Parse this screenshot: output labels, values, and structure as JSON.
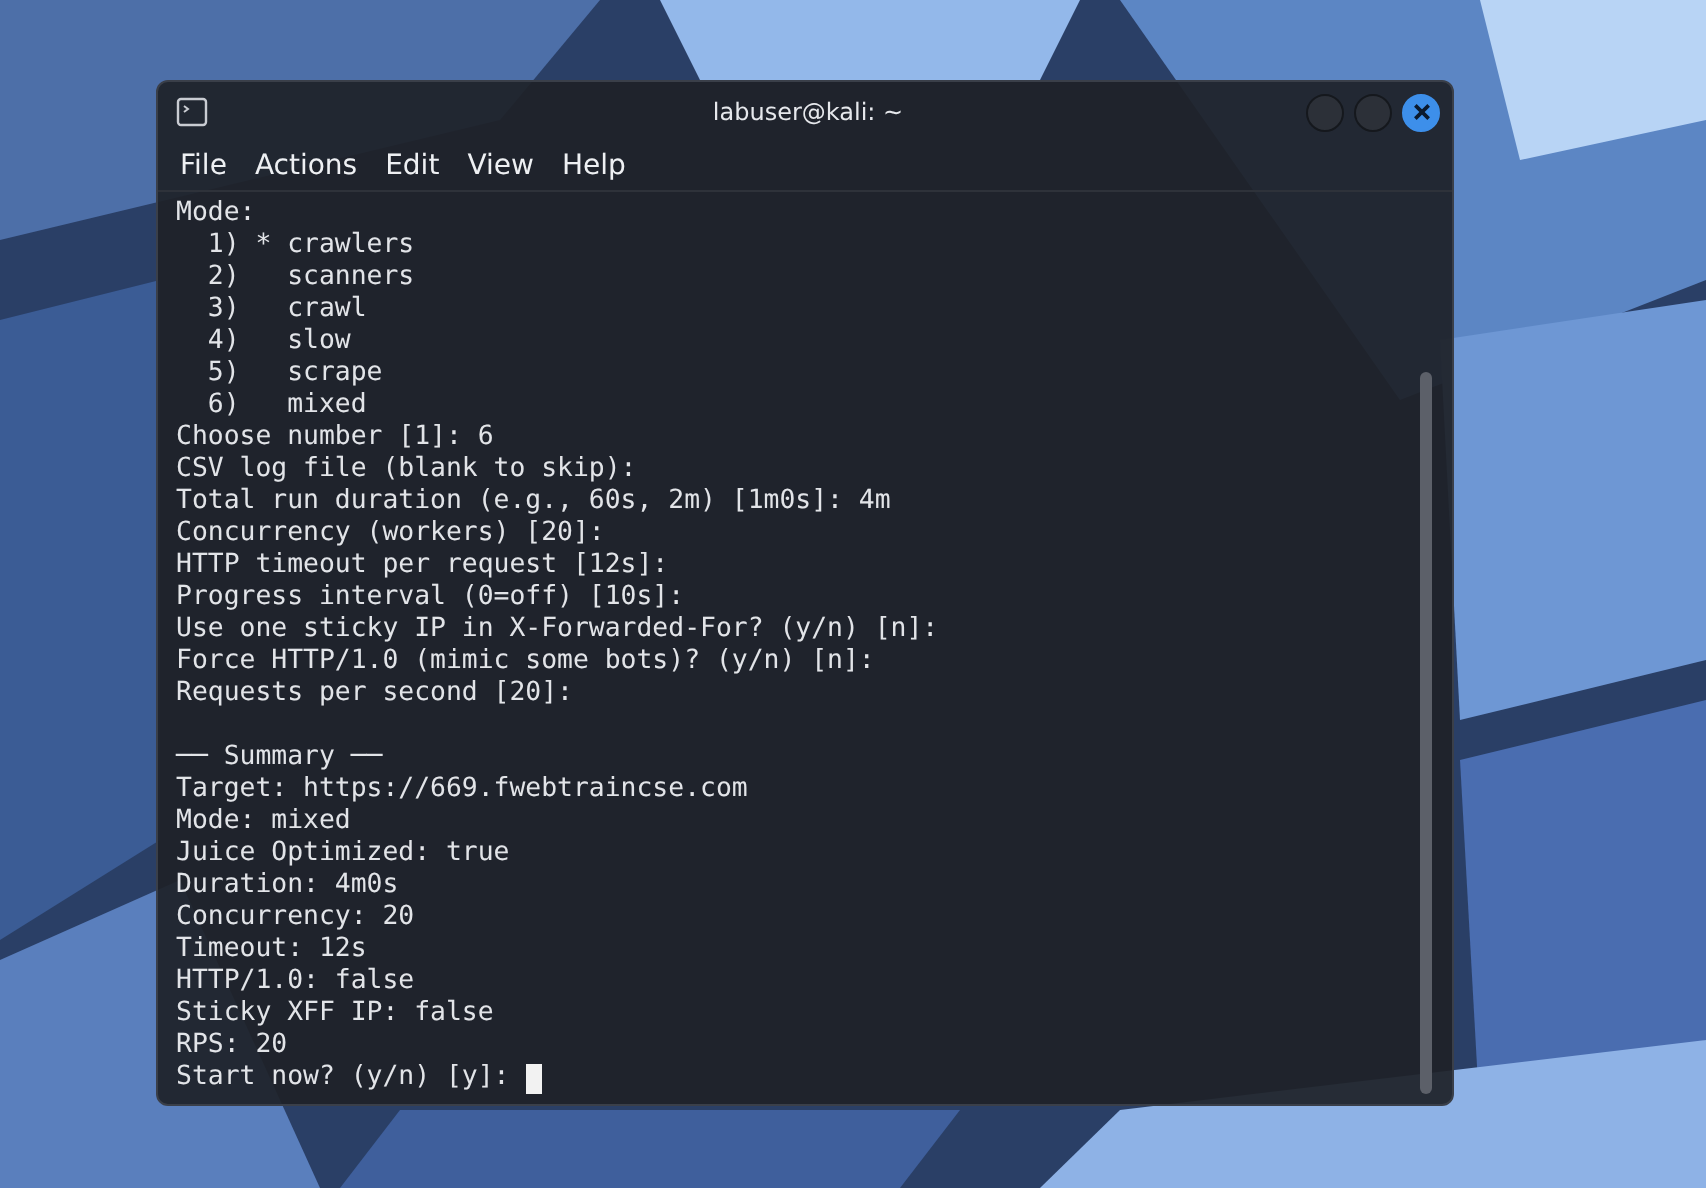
{
  "window": {
    "title": "labuser@kali: ~"
  },
  "menu": [
    "File",
    "Actions",
    "Edit",
    "View",
    "Help"
  ],
  "terminal": {
    "prompt_lines": [
      "Mode:",
      "  1) * crawlers",
      "  2)   scanners",
      "  3)   crawl",
      "  4)   slow",
      "  5)   scrape",
      "  6)   mixed",
      "Choose number [1]: 6",
      "CSV log file (blank to skip):",
      "Total run duration (e.g., 60s, 2m) [1m0s]: 4m",
      "Concurrency (workers) [20]:",
      "HTTP timeout per request [12s]:",
      "Progress interval (0=off) [10s]:",
      "Use one sticky IP in X-Forwarded-For? (y/n) [n]:",
      "Force HTTP/1.0 (mimic some bots)? (y/n) [n]:",
      "Requests per second [20]:"
    ],
    "summary_lines": [
      "── Summary ──",
      "Target: https://669.fwebtraincse.com",
      "Mode: mixed",
      "Juice Optimized: true",
      "Duration: 4m0s",
      "Concurrency: 20",
      "Timeout: 12s",
      "HTTP/1.0: false",
      "Sticky XFF IP: false",
      "RPS: 20"
    ],
    "input_line": {
      "text": "Start now? (y/n) [y]: ",
      "cursor": true
    }
  }
}
